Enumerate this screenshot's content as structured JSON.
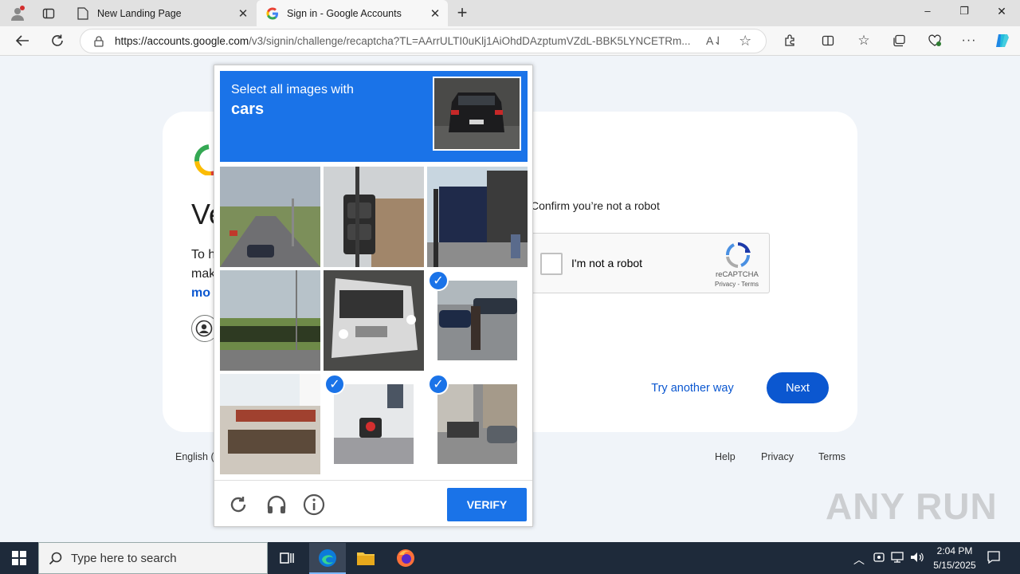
{
  "browser": {
    "tabs": [
      {
        "title": "New Landing Page",
        "close": "✕"
      },
      {
        "title": "Sign in - Google Accounts",
        "close": "✕"
      }
    ],
    "new_tab": "+",
    "url_host": "https://accounts.google.com",
    "url_path": "/v3/signin/challenge/recaptcha?TL=AArrULTI0uKlj1AiOhdDAzptumVZdL-BBK5LYNCETRm...",
    "window_controls": {
      "minimize": "–",
      "maximize": "❐",
      "close": "✕"
    }
  },
  "page": {
    "heading_partial": "Ve",
    "body_lines": [
      "To h",
      "mak",
      "mo"
    ],
    "confirm_text": "Confirm you’re not a robot",
    "recaptcha": {
      "label": "I'm not a robot",
      "brand": "reCAPTCHA",
      "privacy": "Privacy",
      "terms": "Terms",
      "separator": " - "
    },
    "try_another_way": "Try another way",
    "next": "Next",
    "footer": {
      "language": "English (",
      "help": "Help",
      "privacy": "Privacy",
      "terms": "Terms"
    }
  },
  "challenge": {
    "instruction": "Select all images with",
    "target": "cars",
    "tiles": [
      {
        "selected": false
      },
      {
        "selected": false
      },
      {
        "selected": false
      },
      {
        "selected": false
      },
      {
        "selected": false
      },
      {
        "selected": true
      },
      {
        "selected": false
      },
      {
        "selected": true
      },
      {
        "selected": true
      }
    ],
    "verify": "VERIFY"
  },
  "taskbar": {
    "search_placeholder": "Type here to search",
    "time": "2:04 PM",
    "date": "5/15/2025"
  },
  "watermark": "ANY RUN",
  "colors": {
    "accent": "#1a73e8",
    "google_blue": "#0b57d0",
    "taskbar": "#1e2a3a"
  }
}
